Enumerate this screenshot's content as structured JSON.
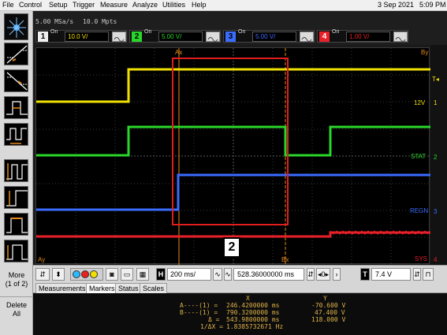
{
  "menu": {
    "items": [
      "File",
      "Control",
      "Setup",
      "Trigger",
      "Measure",
      "Analyze",
      "Utilities",
      "Help"
    ],
    "date": "3 Sep 2021",
    "time": "5:09 PM"
  },
  "acquisition": {
    "sample_rate": "5.00 MSa/s",
    "memory_depth": "10.0 Mpts"
  },
  "channels": [
    {
      "number": "1",
      "state": "On",
      "scale": "10.0 V/",
      "color": "#f0e000"
    },
    {
      "number": "2",
      "state": "On",
      "scale": "5.00 V/",
      "color": "#2ad62a"
    },
    {
      "number": "3",
      "state": "On",
      "scale": "5.00 V/",
      "color": "#3a6cff"
    },
    {
      "number": "4",
      "state": "On",
      "scale": "1.00 V/",
      "color": "#e8202a"
    }
  ],
  "left_toolbar": {
    "more_label": "More",
    "page_label": "(1 of 2)",
    "delete_label": "Delete",
    "all_label": "All"
  },
  "traces": {
    "labels": {
      "ch1": "12V",
      "ch2": "STAT",
      "ch3": "REGN",
      "ch4": "SYS"
    },
    "cursor_labels": {
      "ax": "Ax",
      "bx": "Bx",
      "ay": "Ay",
      "by": "By"
    },
    "channel_markers": {
      "ch1": "1",
      "ch2": "2",
      "ch3": "3",
      "ch4": "4"
    }
  },
  "controls": {
    "timebase_icon": "H",
    "timebase": "200 ms/",
    "delay": "528.36000000 ms",
    "trigger_icon": "T",
    "trigger_level": "7.4 V"
  },
  "tabs": [
    "Measurements",
    "Markers",
    "Status",
    "Scales"
  ],
  "active_tab": "Markers",
  "markers": {
    "header_x": "X",
    "header_y": "Y",
    "a_label": "A----(1) =",
    "a_x": "246.4200000 ms",
    "a_y": "-70.600 V",
    "b_label": "B----(1) =",
    "b_x": "790.3200000 ms",
    "b_y": "47.400 V",
    "delta_label": "Δ =",
    "delta_x": "543.9800000 ms",
    "delta_y": "118.000 V",
    "inv_label": "1/ΔX =",
    "inv_x": "1.8385732671 Hz"
  },
  "annotation": {
    "label": "2",
    "color": "#e01e1e"
  },
  "colors": {
    "ch1": "#f0e000",
    "ch2": "#2ad62a",
    "ch3": "#3a6cff",
    "ch4": "#e8202a",
    "cursor": "#e38a1a",
    "annotation": "#e01e1e"
  }
}
